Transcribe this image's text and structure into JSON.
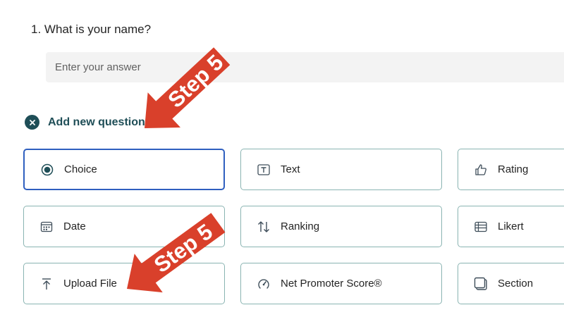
{
  "question": {
    "title": "1. What is your name?",
    "answer_placeholder": "Enter your answer",
    "answer_value": ""
  },
  "add_new": {
    "label": "Add new question",
    "icon": "close-icon"
  },
  "question_types": [
    {
      "label": "Choice",
      "icon": "radio-icon",
      "selected": true
    },
    {
      "label": "Text",
      "icon": "text-icon",
      "selected": false
    },
    {
      "label": "Rating",
      "icon": "thumbs-up-icon",
      "selected": false
    },
    {
      "label": "Date",
      "icon": "calendar-icon",
      "selected": false
    },
    {
      "label": "Ranking",
      "icon": "ranking-icon",
      "selected": false
    },
    {
      "label": "Likert",
      "icon": "likert-icon",
      "selected": false
    },
    {
      "label": "Upload File",
      "icon": "upload-icon",
      "selected": false
    },
    {
      "label": "Net Promoter Score®",
      "icon": "gauge-icon",
      "selected": false
    },
    {
      "label": "Section",
      "icon": "section-icon",
      "selected": false
    }
  ],
  "annotations": [
    {
      "text": "Step 5"
    },
    {
      "text": "Step 5"
    }
  ],
  "colors": {
    "accent": "#1f4e57",
    "selected_border": "#2f5fbf",
    "card_border": "#8ab4b2",
    "annotation_arrow": "#d9402b"
  }
}
